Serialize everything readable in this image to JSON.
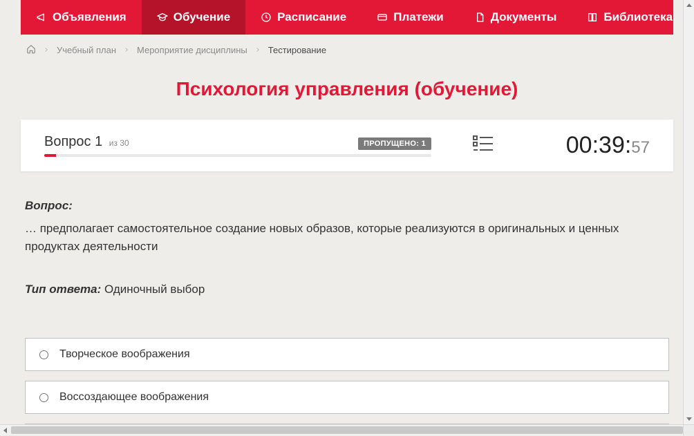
{
  "nav": {
    "items": [
      {
        "label": "Объявления",
        "icon": "megaphone-icon"
      },
      {
        "label": "Обучение",
        "icon": "graduation-icon",
        "active": true
      },
      {
        "label": "Расписание",
        "icon": "clock-icon"
      },
      {
        "label": "Платежи",
        "icon": "card-icon"
      },
      {
        "label": "Документы",
        "icon": "doc-icon"
      },
      {
        "label": "Библиотека",
        "icon": "book-icon",
        "hasDropdown": true
      }
    ]
  },
  "breadcrumb": {
    "items": [
      {
        "label": "Учебный план"
      },
      {
        "label": "Мероприятие дисциплины"
      }
    ],
    "current": "Тестирование"
  },
  "title": "Психология управления (обучение)",
  "status": {
    "question_label": "Вопрос",
    "question_number": "1",
    "of_prefix": "из",
    "total": "30",
    "skipped_label": "ПРОПУЩЕНО: 1",
    "timer_main": "00:39:",
    "timer_sec": "57",
    "progress_percent": 3
  },
  "question": {
    "heading": "Вопрос:",
    "text": "… предполагает самостоятельное создание новых образов, которые реализуются в оригинальных и ценных продуктах деятельности",
    "answer_type_label": "Тип ответа:",
    "answer_type_value": "Одиночный выбор"
  },
  "answers": [
    {
      "label": "Творческое воображения"
    },
    {
      "label": "Воссоздающее воображения"
    }
  ]
}
